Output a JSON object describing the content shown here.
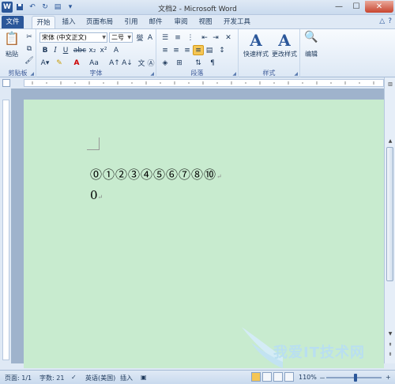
{
  "window": {
    "title": "文档2 - Microsoft Word",
    "app_icon_letter": "W"
  },
  "quick_access": [
    "save-icon",
    "undo-icon",
    "redo-icon",
    "print-preview-icon",
    "customize-icon"
  ],
  "tabs": [
    {
      "label": "文件"
    },
    {
      "label": "开始"
    },
    {
      "label": "插入"
    },
    {
      "label": "页面布局"
    },
    {
      "label": "引用"
    },
    {
      "label": "邮件"
    },
    {
      "label": "审阅"
    },
    {
      "label": "视图"
    },
    {
      "label": "开发工具"
    }
  ],
  "ribbon": {
    "clipboard": {
      "label": "剪贴板",
      "paste_label": "粘贴"
    },
    "font": {
      "label": "字体",
      "font_name": "宋体 (中文正文)",
      "font_size": "二号"
    },
    "paragraph": {
      "label": "段落"
    },
    "styles": {
      "label": "样式",
      "quick_styles": "快速样式",
      "change_styles": "更改样式"
    },
    "editing": {
      "label": "编辑"
    }
  },
  "document": {
    "line1": "⓪①②③④⑤⑥⑦⑧⑩",
    "line2": "0",
    "paragraph_mark": "↵"
  },
  "status": {
    "page": "页面: 1/1",
    "words": "字数: 21",
    "language": "英语(美国)",
    "mode": "插入",
    "zoom": "110%",
    "zoom_minus": "－",
    "zoom_plus": "+"
  },
  "watermark": {
    "text": "我爱IT技术网"
  },
  "colors": {
    "page_bg": "#c8ebcf",
    "file_tab": "#2b579a",
    "highlight": "#f5c654"
  }
}
